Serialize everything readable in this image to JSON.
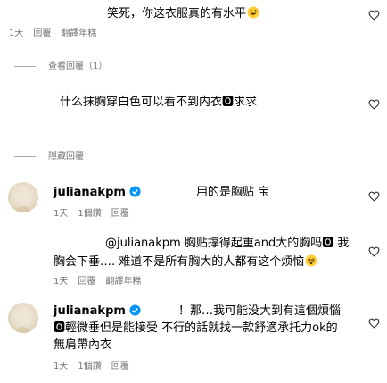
{
  "comments": [
    {
      "text": "笑死，你这衣服真的有水平",
      "emoji": "laughing-emoji",
      "meta": {
        "time": "1天",
        "reply": "回覆",
        "translate": "翻譯年糕"
      }
    },
    {
      "text": "什么抹胸穿白色可以看不到内衣🅾求求"
    },
    {
      "username": "julianakpm",
      "text": "用的是胸贴 宝",
      "meta": {
        "time": "1天",
        "likes": "1個讚",
        "reply": "回覆"
      }
    },
    {
      "line1": "@julianakpm 胸贴撑得起重and大的胸吗🅾 我",
      "line2": "胸会下垂…. 难道不是所有胸大的人都有这个烦恼",
      "emoji": "dizzy-face-emoji",
      "meta": {
        "time": "1天",
        "reply": "回覆",
        "translate": "翻譯年糕"
      }
    },
    {
      "username": "julianakpm",
      "line1": "！那…我可能没大到有這個煩惱",
      "line2": "🅾輕微垂但是能接受 不行的話就找一款舒適承托力ok的",
      "line3": "無肩帶內衣",
      "meta": {
        "time": "1天",
        "likes": "1個讚",
        "reply": "回覆"
      }
    }
  ],
  "view_replies": "查看回覆（1）",
  "hide_replies": "隱藏回覆",
  "colors": {
    "verified": "#0095f6",
    "muted": "#737373",
    "heart": "#262626"
  }
}
